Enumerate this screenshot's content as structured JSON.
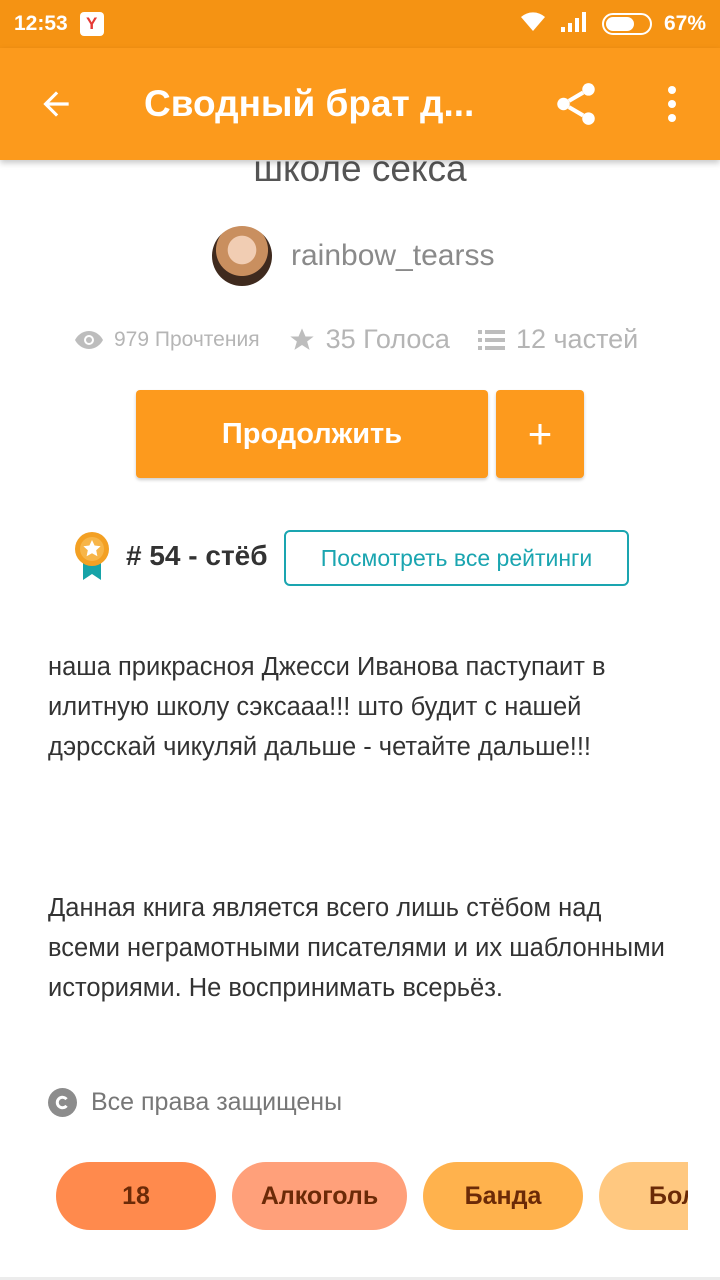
{
  "status_bar": {
    "time": "12:53",
    "notification_badge": "Y",
    "battery_percent": "67%",
    "battery_level": 0.67
  },
  "app_bar": {
    "title": "Сводный брат д..."
  },
  "story": {
    "title_tail": "школе секса",
    "author": "rainbow_tearss",
    "stats": {
      "reads": "979 Прочтения",
      "votes": "35 Голоса",
      "parts": "12 частей"
    },
    "continue_label": "Продолжить",
    "add_label": "+",
    "rank_text": "# 54 - стёб",
    "ratings_button": "Посмотреть все рейтинги",
    "description_1": "наша прикрасноя Джесси Иванова паступаит в илитную школу сэксааа!!! што будит с нашей дэрсскай чикуляй дальше - четайте дальше!!!",
    "description_2": "Данная книга является всего лишь стёбом над всеми неграмотными писателями и их шаблонными историями. Не воспринимать всерьёз.",
    "copyright": "Все права защищены",
    "tags": [
      {
        "label": "18",
        "color": "#ff8a4d"
      },
      {
        "label": "Алкоголь",
        "color": "#ffa07a"
      },
      {
        "label": "Банда",
        "color": "#ffb24d"
      },
      {
        "label": "Бол",
        "color": "#ffc880"
      }
    ]
  },
  "colors": {
    "accent": "#fc9a1c",
    "status_bar": "#f59313",
    "teal": "#1aa5b0"
  }
}
